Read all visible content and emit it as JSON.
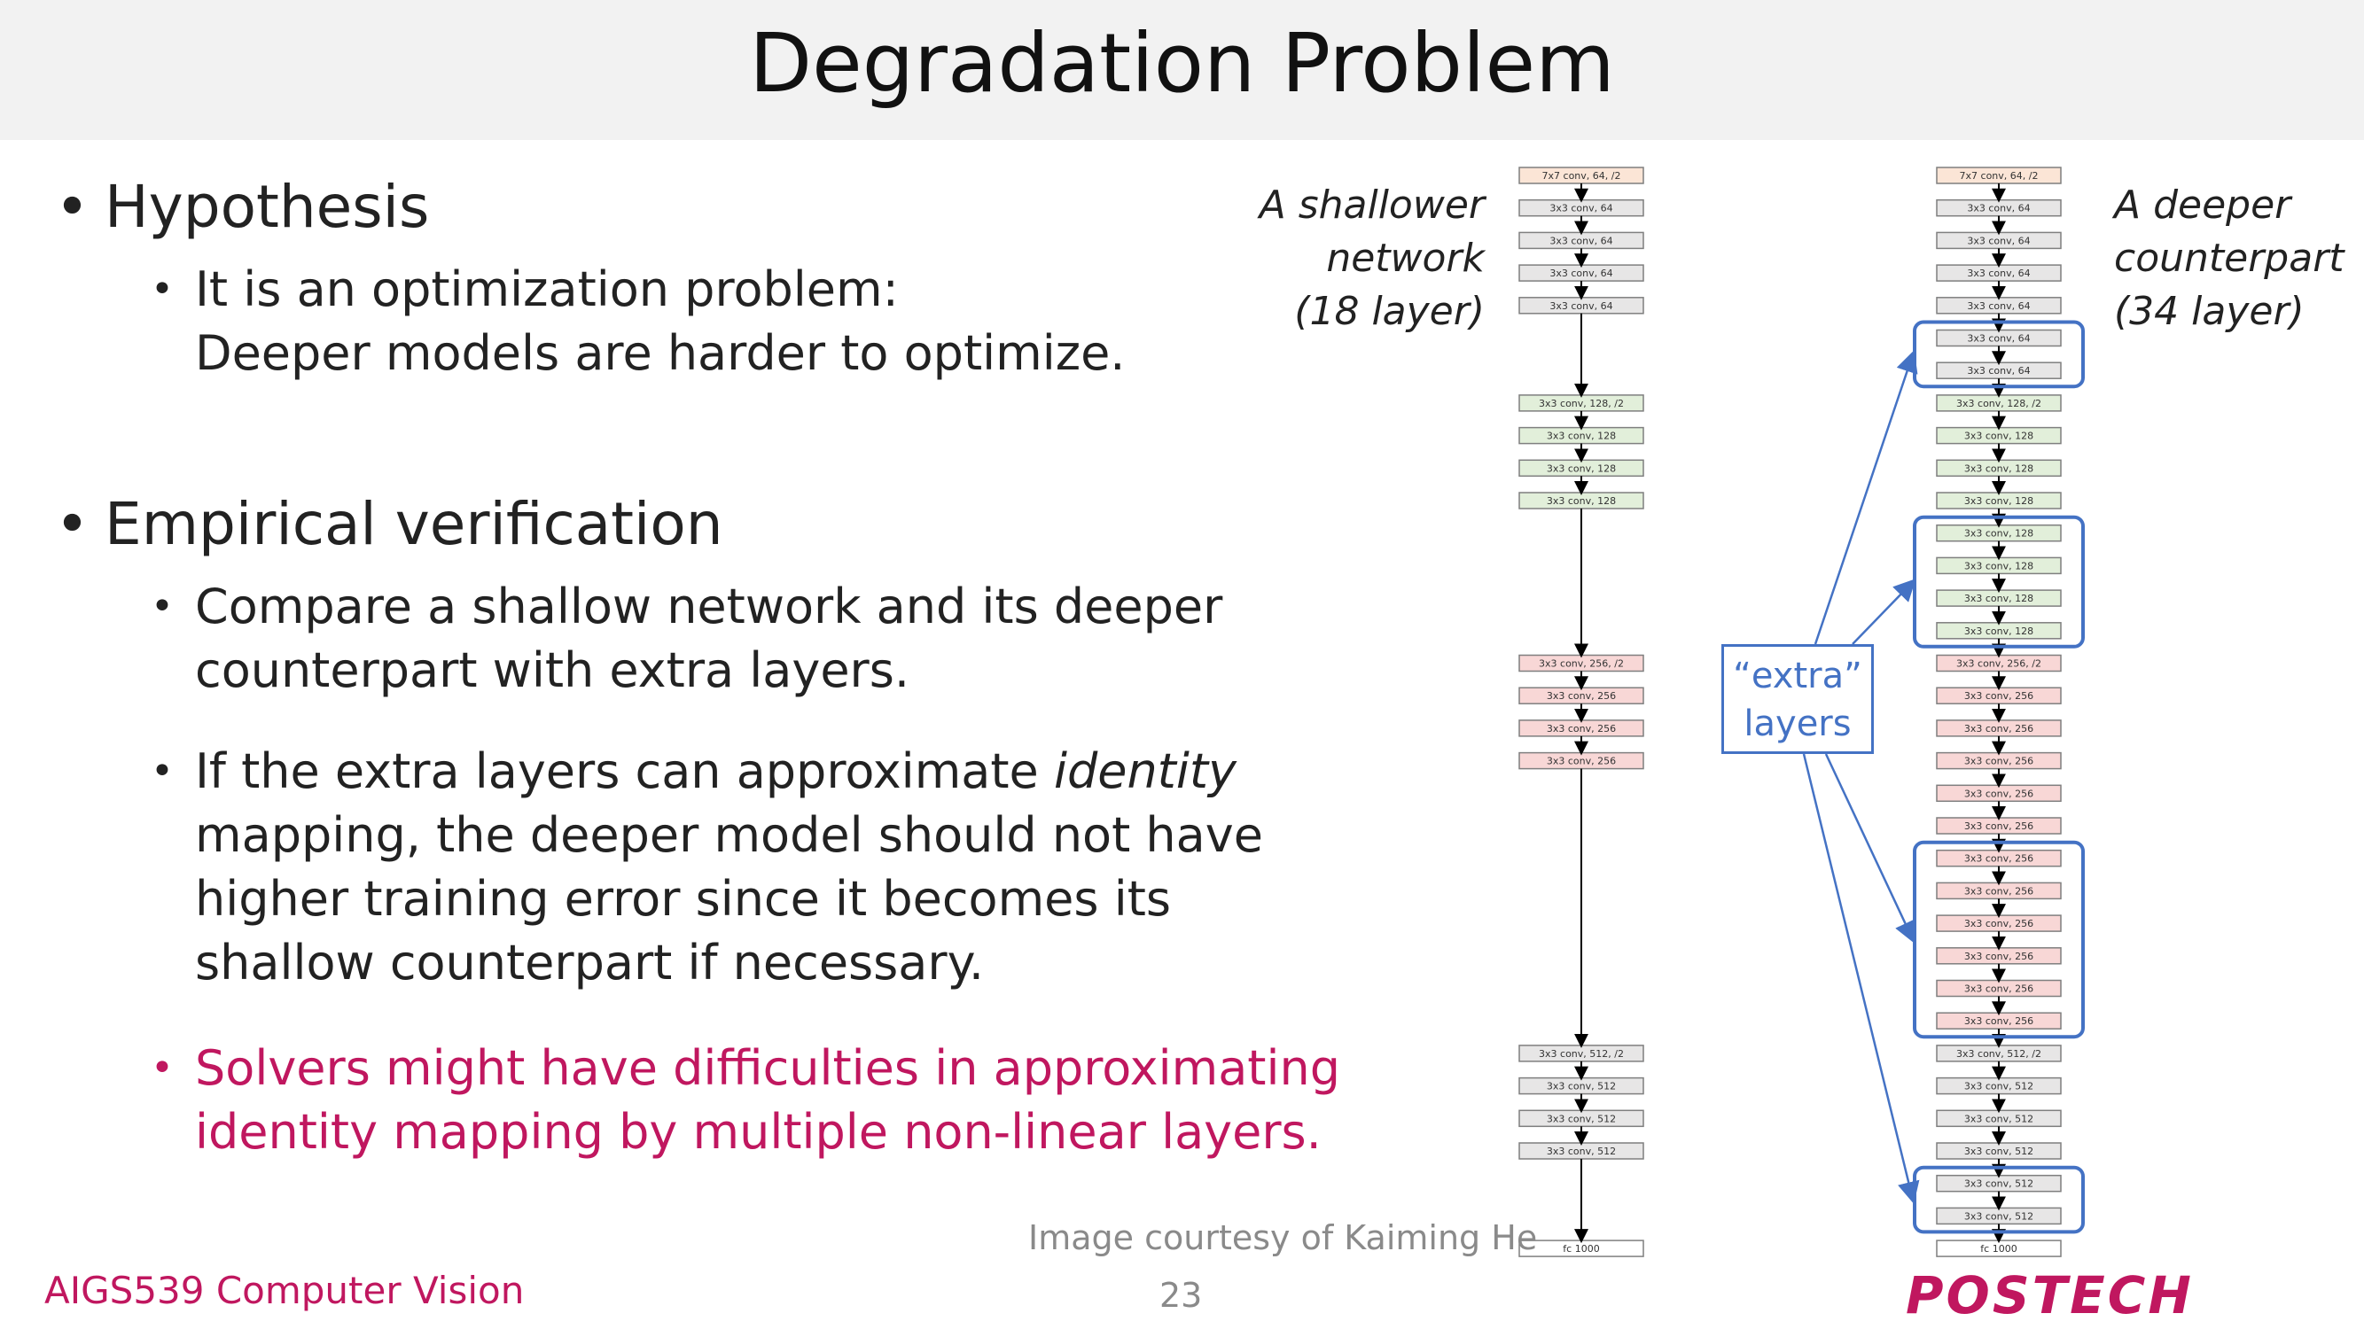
{
  "slide": {
    "title": "Degradation Problem",
    "course": "AIGS539 Computer Vision",
    "page_number": "23",
    "logo_text": "POSTECH",
    "courtesy": "Image courtesy of Kaiming He"
  },
  "bullets": [
    {
      "level": 1,
      "text": "Hypothesis"
    },
    {
      "level": 2,
      "lines": [
        "It is an optimization problem:",
        "Deeper models are harder to optimize."
      ]
    },
    {
      "level": 1,
      "text": "Empirical verification"
    },
    {
      "level": 2,
      "lines": [
        "Compare a shallow network and its deeper",
        "counterpart with extra layers."
      ]
    },
    {
      "level": 2,
      "lines": [
        "If the extra layers can approximate identity",
        "mapping, the deeper model should not have",
        "higher training error since it becomes its",
        "shallow counterpart if necessary."
      ],
      "italic_word": "identity"
    },
    {
      "level": 2,
      "lines": [
        "Solvers might have difficulties in approximating",
        "identity mapping by multiple non-linear layers."
      ],
      "highlight": true
    }
  ],
  "diagram": {
    "shallow_label": [
      "A shallower",
      "network",
      "(18 layer)"
    ],
    "deep_label": [
      "A deeper",
      "counterpart",
      "(34 layer)"
    ],
    "extra_label": [
      "“extra”",
      "layers"
    ],
    "colors": {
      "conv64_first": "#fbe5d6",
      "conv64": "#e7e6e6",
      "conv128": "#e2efda",
      "conv256": "#f8d7d6",
      "conv512": "#e7e6e6",
      "fc": "#ffffff",
      "extra": "#4472c4",
      "arrow": "#000000"
    },
    "shallow_layers": [
      "7x7 conv, 64, /2",
      "3x3 conv, 64",
      "3x3 conv, 64",
      "3x3 conv, 64",
      "3x3 conv, 64",
      "3x3 conv, 128, /2",
      "3x3 conv, 128",
      "3x3 conv, 128",
      "3x3 conv, 128",
      "3x3 conv, 256, /2",
      "3x3 conv, 256",
      "3x3 conv, 256",
      "3x3 conv, 256",
      "3x3 conv, 512, /2",
      "3x3 conv, 512",
      "3x3 conv, 512",
      "3x3 conv, 512",
      "fc 1000"
    ],
    "deep_layers": [
      "7x7 conv, 64, /2",
      "3x3 conv, 64",
      "3x3 conv, 64",
      "3x3 conv, 64",
      "3x3 conv, 64",
      "3x3 conv, 64",
      "3x3 conv, 64",
      "3x3 conv, 128, /2",
      "3x3 conv, 128",
      "3x3 conv, 128",
      "3x3 conv, 128",
      "3x3 conv, 128",
      "3x3 conv, 128",
      "3x3 conv, 128",
      "3x3 conv, 128",
      "3x3 conv, 256, /2",
      "3x3 conv, 256",
      "3x3 conv, 256",
      "3x3 conv, 256",
      "3x3 conv, 256",
      "3x3 conv, 256",
      "3x3 conv, 256",
      "3x3 conv, 256",
      "3x3 conv, 256",
      "3x3 conv, 256",
      "3x3 conv, 256",
      "3x3 conv, 256",
      "3x3 conv, 512, /2",
      "3x3 conv, 512",
      "3x3 conv, 512",
      "3x3 conv, 512",
      "3x3 conv, 512",
      "3x3 conv, 512",
      "fc 1000"
    ]
  }
}
